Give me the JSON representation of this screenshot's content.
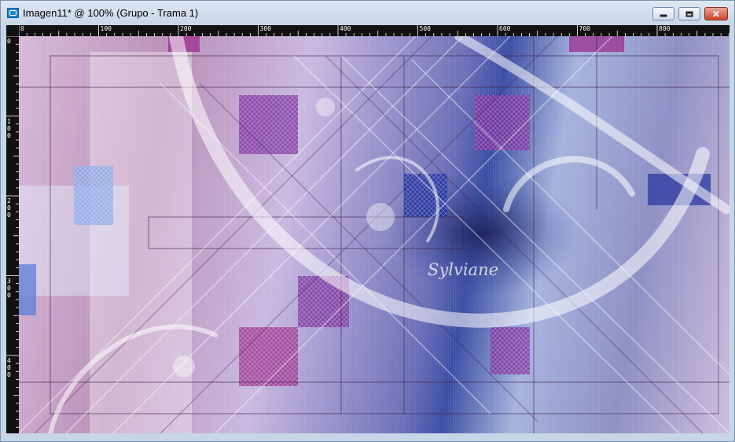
{
  "window": {
    "title": "Imagen11* @ 100% (Grupo - Trama 1)",
    "app_icon": "psp-app-icon",
    "buttons": {
      "minimize": "minimize-icon",
      "maximize": "maximize-icon",
      "close": "close-icon"
    },
    "close_glyph": "✕"
  },
  "ruler": {
    "horizontal": [
      "0",
      "100",
      "200",
      "300",
      "400",
      "500",
      "600",
      "700",
      "800"
    ],
    "vertical": [
      "0",
      "100",
      "200",
      "300",
      "400"
    ]
  },
  "canvas": {
    "watermark": "Sylviane",
    "colors": {
      "pink": "#c48bbd",
      "lavender": "#c9b9e0",
      "blue": "#3b4da3",
      "magenta": "#9b2f8f",
      "light": "#e6e6f6"
    }
  }
}
